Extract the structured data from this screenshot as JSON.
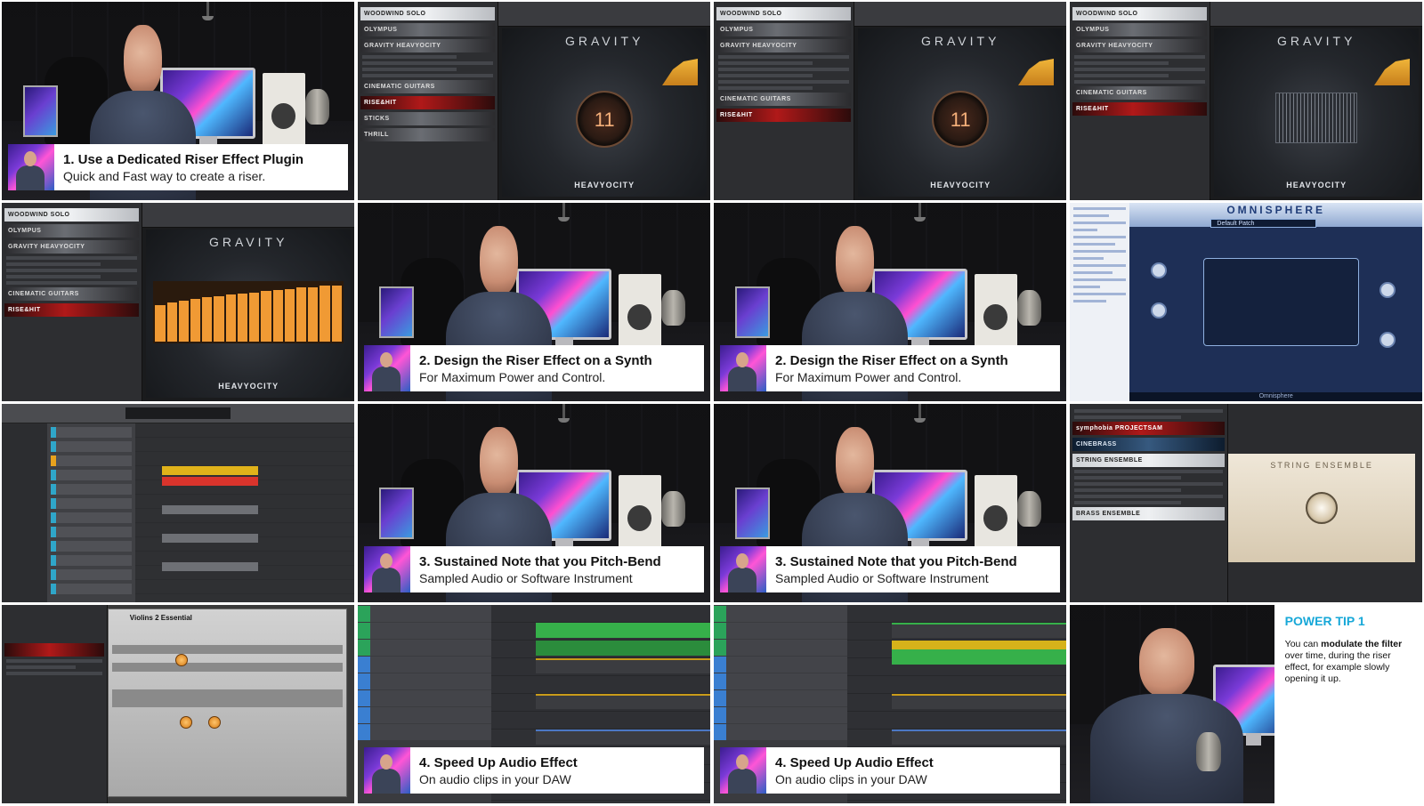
{
  "captions": [
    {
      "title": "1. Use a Dedicated Riser Effect Plugin",
      "sub": "Quick and Fast way to create a riser."
    },
    {
      "title": "2. Design the Riser Effect on a Synth",
      "sub": "For Maximum Power and Control."
    },
    {
      "title": "2. Design the Riser Effect on a Synth",
      "sub": "For Maximum Power and Control."
    },
    {
      "title": "3. Sustained Note that you Pitch-Bend",
      "sub": "Sampled Audio or Software Instrument"
    },
    {
      "title": "3. Sustained Note that you Pitch-Bend",
      "sub": "Sampled Audio or Software Instrument"
    },
    {
      "title": "4. Speed Up Audio Effect",
      "sub": "On audio clips in your DAW"
    },
    {
      "title": "4. Speed Up Audio Effect",
      "sub": "On audio clips in your DAW"
    }
  ],
  "kontakt": {
    "libs": [
      "WOODWIND SOLO",
      "OLYMPUS",
      "GRAVITY  HEAVYOCITY",
      "CINEMATIC GUITARS",
      "RISE&HIT",
      "STICKS",
      "THRILL"
    ],
    "instrument": "GRAVITY",
    "dial_value": "11",
    "logo": "HEAVYOCITY"
  },
  "omnisphere": {
    "title": "OMNISPHERE",
    "patch": "Default Patch",
    "footer": "Omnisphere"
  },
  "string_ensemble": {
    "title": "STRING ENSEMBLE",
    "libs": [
      "symphobia  PROJECTSAM",
      "CINEBRASS",
      "STRING ENSEMBLE",
      "BRASS ENSEMBLE"
    ]
  },
  "violins": {
    "name": "Violins 2 Essential"
  },
  "power_tip": {
    "title": "POWER TIP 1",
    "body_pre": "You can ",
    "body_bold": "modulate the filter",
    "body_post": " over time, during the riser effect, for example slowly opening it up."
  }
}
